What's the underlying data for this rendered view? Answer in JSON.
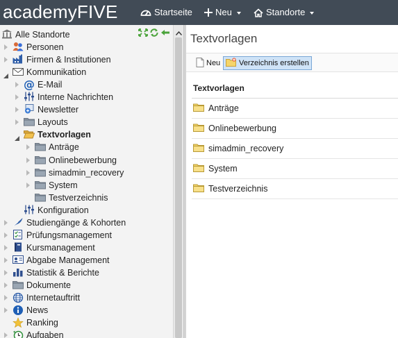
{
  "topbar": {
    "logo": "academyFIVE",
    "nav": [
      {
        "label": "Startseite",
        "icon": "dashboard-icon"
      },
      {
        "label": "Neu",
        "icon": "plus-icon"
      },
      {
        "label": "Standorte",
        "icon": "home-icon"
      }
    ]
  },
  "sidebar": {
    "items": [
      {
        "label": "Alle Standorte",
        "icon": "building-icon"
      },
      {
        "label": "Personen",
        "icon": "persons-icon"
      },
      {
        "label": "Firmen & Institutionen",
        "icon": "factory-icon"
      },
      {
        "label": "Kommunikation",
        "icon": "envelope-icon"
      },
      {
        "label": "E-Mail",
        "icon": "at-icon"
      },
      {
        "label": "Interne Nachrichten",
        "icon": "sliders-icon"
      },
      {
        "label": "Newsletter",
        "icon": "newsletter-icon"
      },
      {
        "label": "Layouts",
        "icon": "folder-icon"
      },
      {
        "label": "Textvorlagen",
        "icon": "folder-open-icon"
      },
      {
        "label": "Anträge",
        "icon": "folder-icon"
      },
      {
        "label": "Onlinebewerbung",
        "icon": "folder-icon"
      },
      {
        "label": "simadmin_recovery",
        "icon": "folder-icon"
      },
      {
        "label": "System",
        "icon": "folder-icon"
      },
      {
        "label": "Testverzeichnis",
        "icon": "folder-icon"
      },
      {
        "label": "Konfiguration",
        "icon": "sliders-icon"
      },
      {
        "label": "Studiengänge & Kohorten",
        "icon": "feather-icon"
      },
      {
        "label": "Prüfungsmanagement",
        "icon": "checklist-icon"
      },
      {
        "label": "Kursmanagement",
        "icon": "book-icon"
      },
      {
        "label": "Abgabe Management",
        "icon": "id-card-icon"
      },
      {
        "label": "Statistik & Berichte",
        "icon": "bar-chart-icon"
      },
      {
        "label": "Dokumente",
        "icon": "folder-icon"
      },
      {
        "label": "Internetauftritt",
        "icon": "globe-icon"
      },
      {
        "label": "News",
        "icon": "info-icon"
      },
      {
        "label": "Ranking",
        "icon": "star-icon"
      },
      {
        "label": "Aufgaben",
        "icon": "clock-icon"
      }
    ]
  },
  "main": {
    "title": "Textvorlagen",
    "toolbar": {
      "new_label": "Neu",
      "create_dir_label": "Verzeichnis erstellen"
    },
    "list_header": "Textvorlagen",
    "rows": [
      "Anträge",
      "Onlinebewerbung",
      "simadmin_recovery",
      "System",
      "Testverzeichnis"
    ]
  },
  "colors": {
    "topbar": "#414b56",
    "sidebar": "#f3f3f3",
    "folder": "#f5d56a",
    "selected_button": "#cfe3f7"
  }
}
